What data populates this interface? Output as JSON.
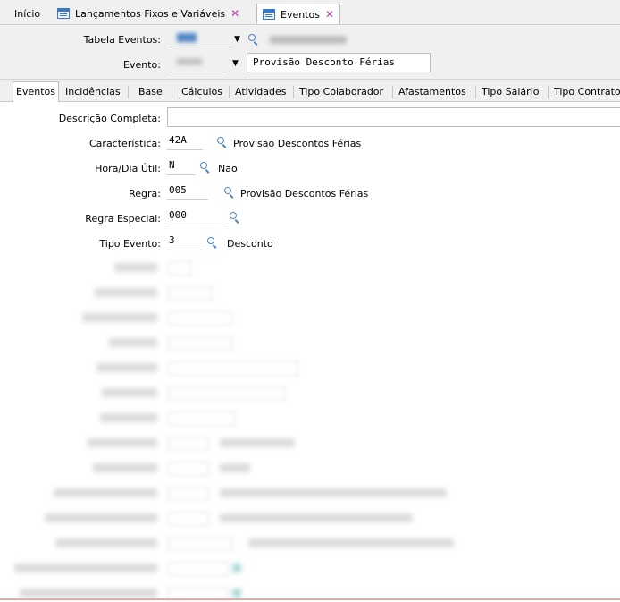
{
  "top_tabs": [
    {
      "label": "Início"
    },
    {
      "label": "Lançamentos Fixos e Variáveis"
    },
    {
      "label": "Eventos"
    }
  ],
  "header": {
    "tabela_label": "Tabela Eventos:",
    "evento_label": "Evento:",
    "evento_descricao": "Provisão Desconto Férias"
  },
  "subtabs": [
    {
      "label": "Eventos"
    },
    {
      "label": "Incidências"
    },
    {
      "label": "Base"
    },
    {
      "label": "Cálculos"
    },
    {
      "label": "Atividades"
    },
    {
      "label": "Tipo Colaborador"
    },
    {
      "label": "Afastamentos"
    },
    {
      "label": "Tipo Salário"
    },
    {
      "label": "Tipo Contrato"
    }
  ],
  "form": {
    "descricao_label": "Descrição Completa:",
    "descricao_value": "",
    "caracteristica_label": "Característica:",
    "caracteristica_code": "42A",
    "caracteristica_desc": "Provisão Descontos Férias",
    "horadia_label": "Hora/Dia Útil:",
    "horadia_code": "N",
    "horadia_desc": "Não",
    "regra_label": "Regra:",
    "regra_code": "005",
    "regra_desc": "Provisão Descontos Férias",
    "regra_especial_label": "Regra Especial:",
    "regra_especial_code": "000",
    "tipo_evento_label": "Tipo Evento:",
    "tipo_evento_code": "3",
    "tipo_evento_desc": "Desconto"
  },
  "icons": {
    "lookup": "magnifier-icon",
    "dropdown": "dropdown-arrow-icon",
    "tab_doc": "document-icon",
    "close": "close-icon"
  },
  "colors": {
    "accent": "#4f86c6",
    "close": "#c03cb0",
    "background": "#f0f0f0"
  }
}
